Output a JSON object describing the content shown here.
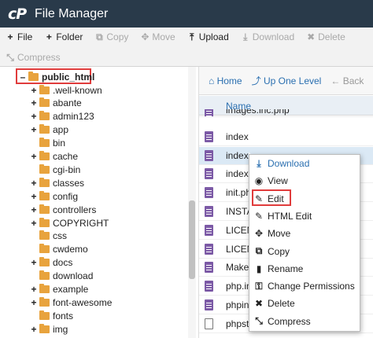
{
  "app": {
    "title": "File Manager",
    "logo": "cP"
  },
  "toolbar": {
    "row1": [
      {
        "label": "File",
        "icon": "+",
        "icon_name": "plus-icon",
        "enabled": true
      },
      {
        "label": "Folder",
        "icon": "+",
        "icon_name": "plus-icon",
        "enabled": true
      },
      {
        "label": "Copy",
        "icon": "⧉",
        "icon_name": "copy-icon",
        "enabled": false
      },
      {
        "label": "Move",
        "icon": "✥",
        "icon_name": "move-icon",
        "enabled": false
      },
      {
        "label": "Upload",
        "icon": "⤒",
        "icon_name": "upload-icon",
        "enabled": true
      },
      {
        "label": "Download",
        "icon": "⤓",
        "icon_name": "download-icon",
        "enabled": false
      },
      {
        "label": "Delete",
        "icon": "✖",
        "icon_name": "delete-icon",
        "enabled": false
      }
    ],
    "row2": [
      {
        "label": "Compress",
        "icon": "⤡",
        "icon_name": "compress-icon",
        "enabled": false
      }
    ]
  },
  "tree": {
    "root": "public_html",
    "items": [
      {
        "label": ".well-known",
        "expandable": true
      },
      {
        "label": "abante",
        "expandable": true
      },
      {
        "label": "admin123",
        "expandable": true
      },
      {
        "label": "app",
        "expandable": true
      },
      {
        "label": "bin",
        "expandable": false
      },
      {
        "label": "cache",
        "expandable": true
      },
      {
        "label": "cgi-bin",
        "expandable": false
      },
      {
        "label": "classes",
        "expandable": true
      },
      {
        "label": "config",
        "expandable": true
      },
      {
        "label": "controllers",
        "expandable": true
      },
      {
        "label": "COPYRIGHT",
        "expandable": true
      },
      {
        "label": "css",
        "expandable": false
      },
      {
        "label": "cwdemo",
        "expandable": false
      },
      {
        "label": "docs",
        "expandable": true
      },
      {
        "label": "download",
        "expandable": false
      },
      {
        "label": "example",
        "expandable": true
      },
      {
        "label": "font-awesome",
        "expandable": true
      },
      {
        "label": "fonts",
        "expandable": false
      },
      {
        "label": "img",
        "expandable": true
      }
    ]
  },
  "nav": {
    "home": "Home",
    "up": "Up One Level",
    "back": "Back"
  },
  "file_list": {
    "column_name": "Name",
    "files": [
      {
        "name": "images.inc.php",
        "type": "php"
      },
      {
        "name": "index",
        "type": "php"
      },
      {
        "name": "index",
        "type": "php",
        "selected": true
      },
      {
        "name": "index.",
        "type": "php"
      },
      {
        "name": "init.ph",
        "type": "php"
      },
      {
        "name": "INSTA",
        "type": "php"
      },
      {
        "name": "LICEN",
        "type": "php"
      },
      {
        "name": "LICEN",
        "type": "php"
      },
      {
        "name": "Make",
        "type": "php"
      },
      {
        "name": "php.in",
        "type": "php"
      },
      {
        "name": "phpinf",
        "type": "php"
      },
      {
        "name": "phpsta",
        "type": "blank"
      }
    ]
  },
  "context_menu": {
    "items": [
      {
        "label": "Download",
        "icon": "⤓",
        "icon_name": "download-icon"
      },
      {
        "label": "View",
        "icon": "◉",
        "icon_name": "eye-icon"
      },
      {
        "label": "Edit",
        "icon": "✎",
        "icon_name": "pencil-icon",
        "highlighted": true
      },
      {
        "label": "HTML Edit",
        "icon": "✎",
        "icon_name": "html-edit-icon"
      },
      {
        "label": "Move",
        "icon": "✥",
        "icon_name": "move-icon"
      },
      {
        "label": "Copy",
        "icon": "⧉",
        "icon_name": "copy-icon"
      },
      {
        "label": "Rename",
        "icon": "▮",
        "icon_name": "rename-icon"
      },
      {
        "label": "Change Permissions",
        "icon": "⚿",
        "icon_name": "key-icon"
      },
      {
        "label": "Delete",
        "icon": "✖",
        "icon_name": "delete-icon"
      },
      {
        "label": "Compress",
        "icon": "⤡",
        "icon_name": "compress-icon"
      }
    ]
  },
  "colors": {
    "titlebar": "#293a4a",
    "accent": "#2a6fb0",
    "highlight_box": "#e03c3c",
    "folder": "#e8a33d",
    "file_icon": "#7c5aa6"
  }
}
